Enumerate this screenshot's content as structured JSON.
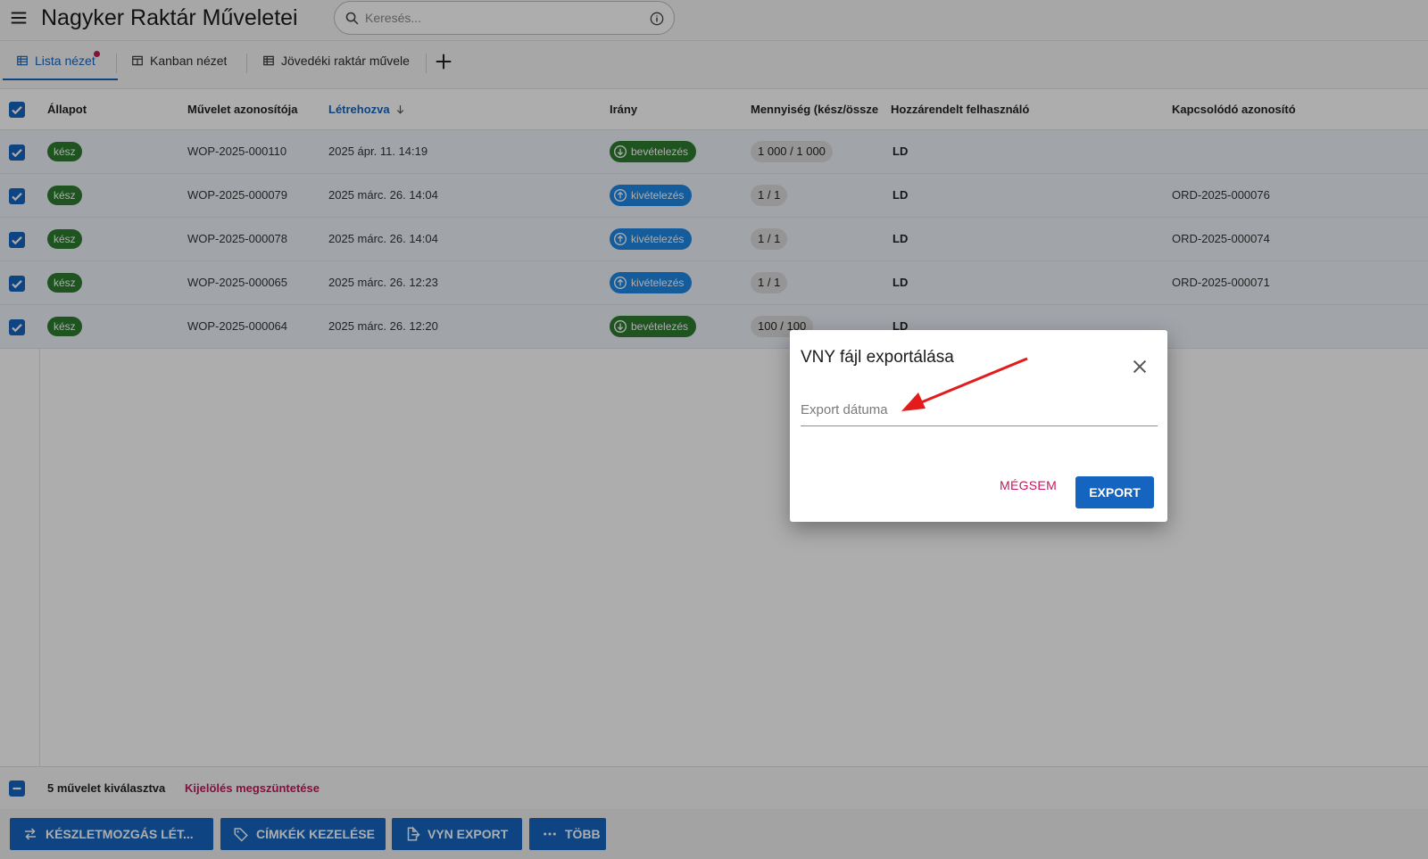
{
  "header": {
    "title": "Nagyker Raktár Műveletei",
    "search_placeholder": "Keresés..."
  },
  "tabs": [
    {
      "label": "Lista nézet",
      "active": true,
      "has_dot": true
    },
    {
      "label": "Kanban nézet",
      "active": false
    },
    {
      "label": "Jövedéki raktár művele",
      "active": false
    }
  ],
  "table": {
    "columns": [
      "Állapot",
      "Művelet azonosítója",
      "Létrehozva",
      "Irány",
      "Mennyiség (kész/össze",
      "Hozzárendelt felhasználó",
      "Kapcsolódó azonosító"
    ],
    "sorted_column": "Létrehozva",
    "rows": [
      {
        "status": "kész",
        "id": "WOP-2025-000110",
        "created": "2025 ápr. 11. 14:19",
        "direction": "bevételezés",
        "dir_type": "in",
        "qty": "1 000  /  1 000",
        "user": "LD",
        "related": ""
      },
      {
        "status": "kész",
        "id": "WOP-2025-000079",
        "created": "2025 márc. 26. 14:04",
        "direction": "kivételezés",
        "dir_type": "out",
        "qty": "1  /  1",
        "user": "LD",
        "related": "ORD-2025-000076"
      },
      {
        "status": "kész",
        "id": "WOP-2025-000078",
        "created": "2025 márc. 26. 14:04",
        "direction": "kivételezés",
        "dir_type": "out",
        "qty": "1  /  1",
        "user": "LD",
        "related": "ORD-2025-000074"
      },
      {
        "status": "kész",
        "id": "WOP-2025-000065",
        "created": "2025 márc. 26. 12:23",
        "direction": "kivételezés",
        "dir_type": "out",
        "qty": "1  /  1",
        "user": "LD",
        "related": "ORD-2025-000071"
      },
      {
        "status": "kész",
        "id": "WOP-2025-000064",
        "created": "2025 márc. 26. 12:20",
        "direction": "bevételezés",
        "dir_type": "in",
        "qty": "100  /  100",
        "user": "LD",
        "related": ""
      }
    ]
  },
  "selection": {
    "count_label": "5 művelet kiválasztva",
    "clear_label": "Kijelölés megszüntetése"
  },
  "actions": [
    {
      "label": "KÉSZLETMOZGÁS LÉT...",
      "icon": "transfer-icon"
    },
    {
      "label": "CÍMKÉK KEZELÉSE",
      "icon": "tag-icon"
    },
    {
      "label": "VYN EXPORT",
      "icon": "file-export-icon"
    },
    {
      "label": "TÖBB",
      "icon": "more-icon"
    }
  ],
  "dialog": {
    "title": "VNY fájl exportálása",
    "field_placeholder": "Export dátuma",
    "cancel_label": "MÉGSEM",
    "confirm_label": "EXPORT"
  },
  "colors": {
    "primary": "#1565c0",
    "success": "#2e7d32",
    "info": "#1e88e5",
    "danger": "#c2185b",
    "annotation": "#e31b1b"
  }
}
